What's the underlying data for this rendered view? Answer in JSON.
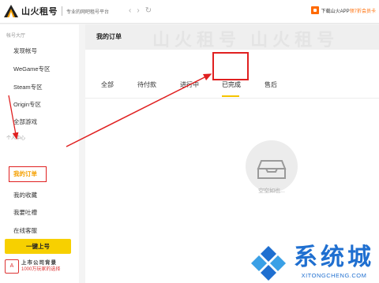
{
  "header": {
    "brand": "山火租号",
    "slogan": "专业的网吧租号平台",
    "nav_back": "‹",
    "nav_forward": "›",
    "nav_refresh": "↻",
    "download_prefix": "下载山火APP",
    "download_accent": "领7折会员卡"
  },
  "sidebar": {
    "section_hall": "帐号大厅",
    "hall_items": [
      {
        "label": "发现帐号"
      },
      {
        "label": "WeGame专区"
      },
      {
        "label": "Steam专区"
      },
      {
        "label": "Origin专区"
      },
      {
        "label": "全部游戏"
      }
    ],
    "section_personal": "个人中心",
    "personal_items": [
      {
        "label": "我的订单",
        "active": true
      },
      {
        "label": "我的收藏"
      },
      {
        "label": "我要吐槽"
      },
      {
        "label": "在线客服"
      }
    ],
    "onekey_label": "一键上号",
    "listed_badge": "A",
    "listed_line1": "上市公司背景",
    "listed_line2": "1000万玩家的选择"
  },
  "main": {
    "banner_watermark": "山火租号 山火租号",
    "page_title": "我的订单",
    "tabs": [
      {
        "label": "全部"
      },
      {
        "label": "待付款"
      },
      {
        "label": "进行中"
      },
      {
        "label": "已完成",
        "active": true
      },
      {
        "label": "售后"
      }
    ],
    "empty_text": "空空如也..."
  },
  "watermark": {
    "name": "系统城",
    "url": "XITONGCHENG.COM"
  },
  "colors": {
    "accent_yellow": "#f5c400",
    "annotation_red": "#e02020",
    "brand_blue": "#1f6fd0",
    "download_orange": "#ff6a00"
  }
}
